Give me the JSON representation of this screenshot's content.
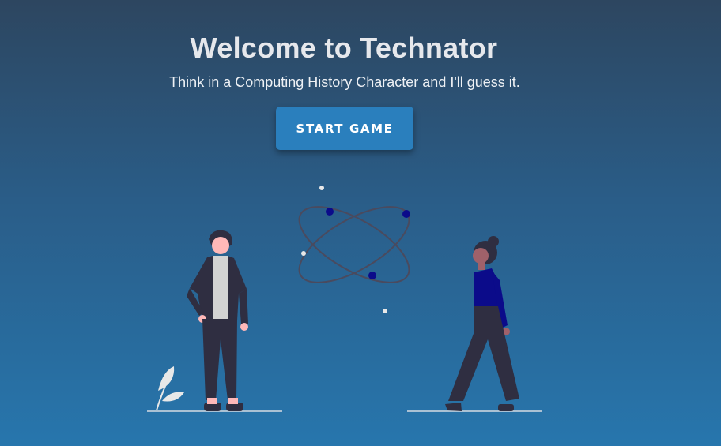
{
  "header": {
    "title": "Welcome to Technator",
    "subtitle": "Think in a Computing History Character and I'll guess it."
  },
  "actions": {
    "start_label": "START GAME"
  },
  "colors": {
    "accent": "#2a7fbd",
    "atom_electron": "#0b0b8a",
    "figure_dark": "#2f2e41"
  },
  "illustration": {
    "icons": [
      "atom-icon",
      "plant-icon",
      "man-figure",
      "woman-figure"
    ]
  }
}
